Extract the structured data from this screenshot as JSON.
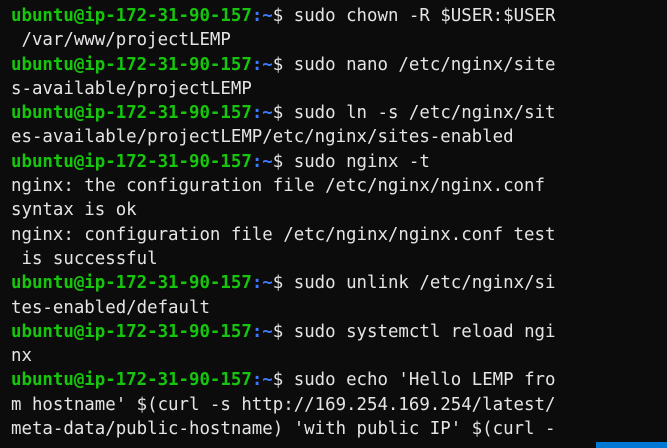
{
  "terminal": {
    "prompt": {
      "user_host": "ubuntu@ip-172-31-90-157",
      "separator": ":",
      "path": "~",
      "symbol": "$"
    },
    "lines": [
      {
        "kind": "prompt",
        "text": " sudo chown -R $USER:$USER"
      },
      {
        "kind": "output",
        "text": " /var/www/projectLEMP"
      },
      {
        "kind": "prompt",
        "text": " sudo nano /etc/nginx/site"
      },
      {
        "kind": "output",
        "text": "s-available/projectLEMP"
      },
      {
        "kind": "prompt",
        "text": " sudo ln -s /etc/nginx/sit"
      },
      {
        "kind": "output",
        "text": "es-available/projectLEMP/etc/nginx/sites-enabled"
      },
      {
        "kind": "prompt",
        "text": " sudo nginx -t"
      },
      {
        "kind": "output",
        "text": "nginx: the configuration file /etc/nginx/nginx.conf"
      },
      {
        "kind": "output",
        "text": "syntax is ok"
      },
      {
        "kind": "output",
        "text": "nginx: configuration file /etc/nginx/nginx.conf test"
      },
      {
        "kind": "output",
        "text": " is successful"
      },
      {
        "kind": "prompt",
        "text": " sudo unlink /etc/nginx/si"
      },
      {
        "kind": "output",
        "text": "tes-enabled/default"
      },
      {
        "kind": "prompt",
        "text": " sudo systemctl reload ngi"
      },
      {
        "kind": "output",
        "text": "nx"
      },
      {
        "kind": "prompt",
        "text": " sudo echo 'Hello LEMP fro"
      },
      {
        "kind": "output",
        "text": "m hostname' $(curl -s http://169.254.169.254/latest/"
      },
      {
        "kind": "output",
        "text": "meta-data/public-hostname) 'with public IP' $(curl -"
      }
    ]
  },
  "colors": {
    "background": "#0c0c0c",
    "prompt_user_host": "#16c60c",
    "prompt_path": "#3b78ff",
    "text": "#e5e5e5",
    "accent": "#0078d4"
  }
}
